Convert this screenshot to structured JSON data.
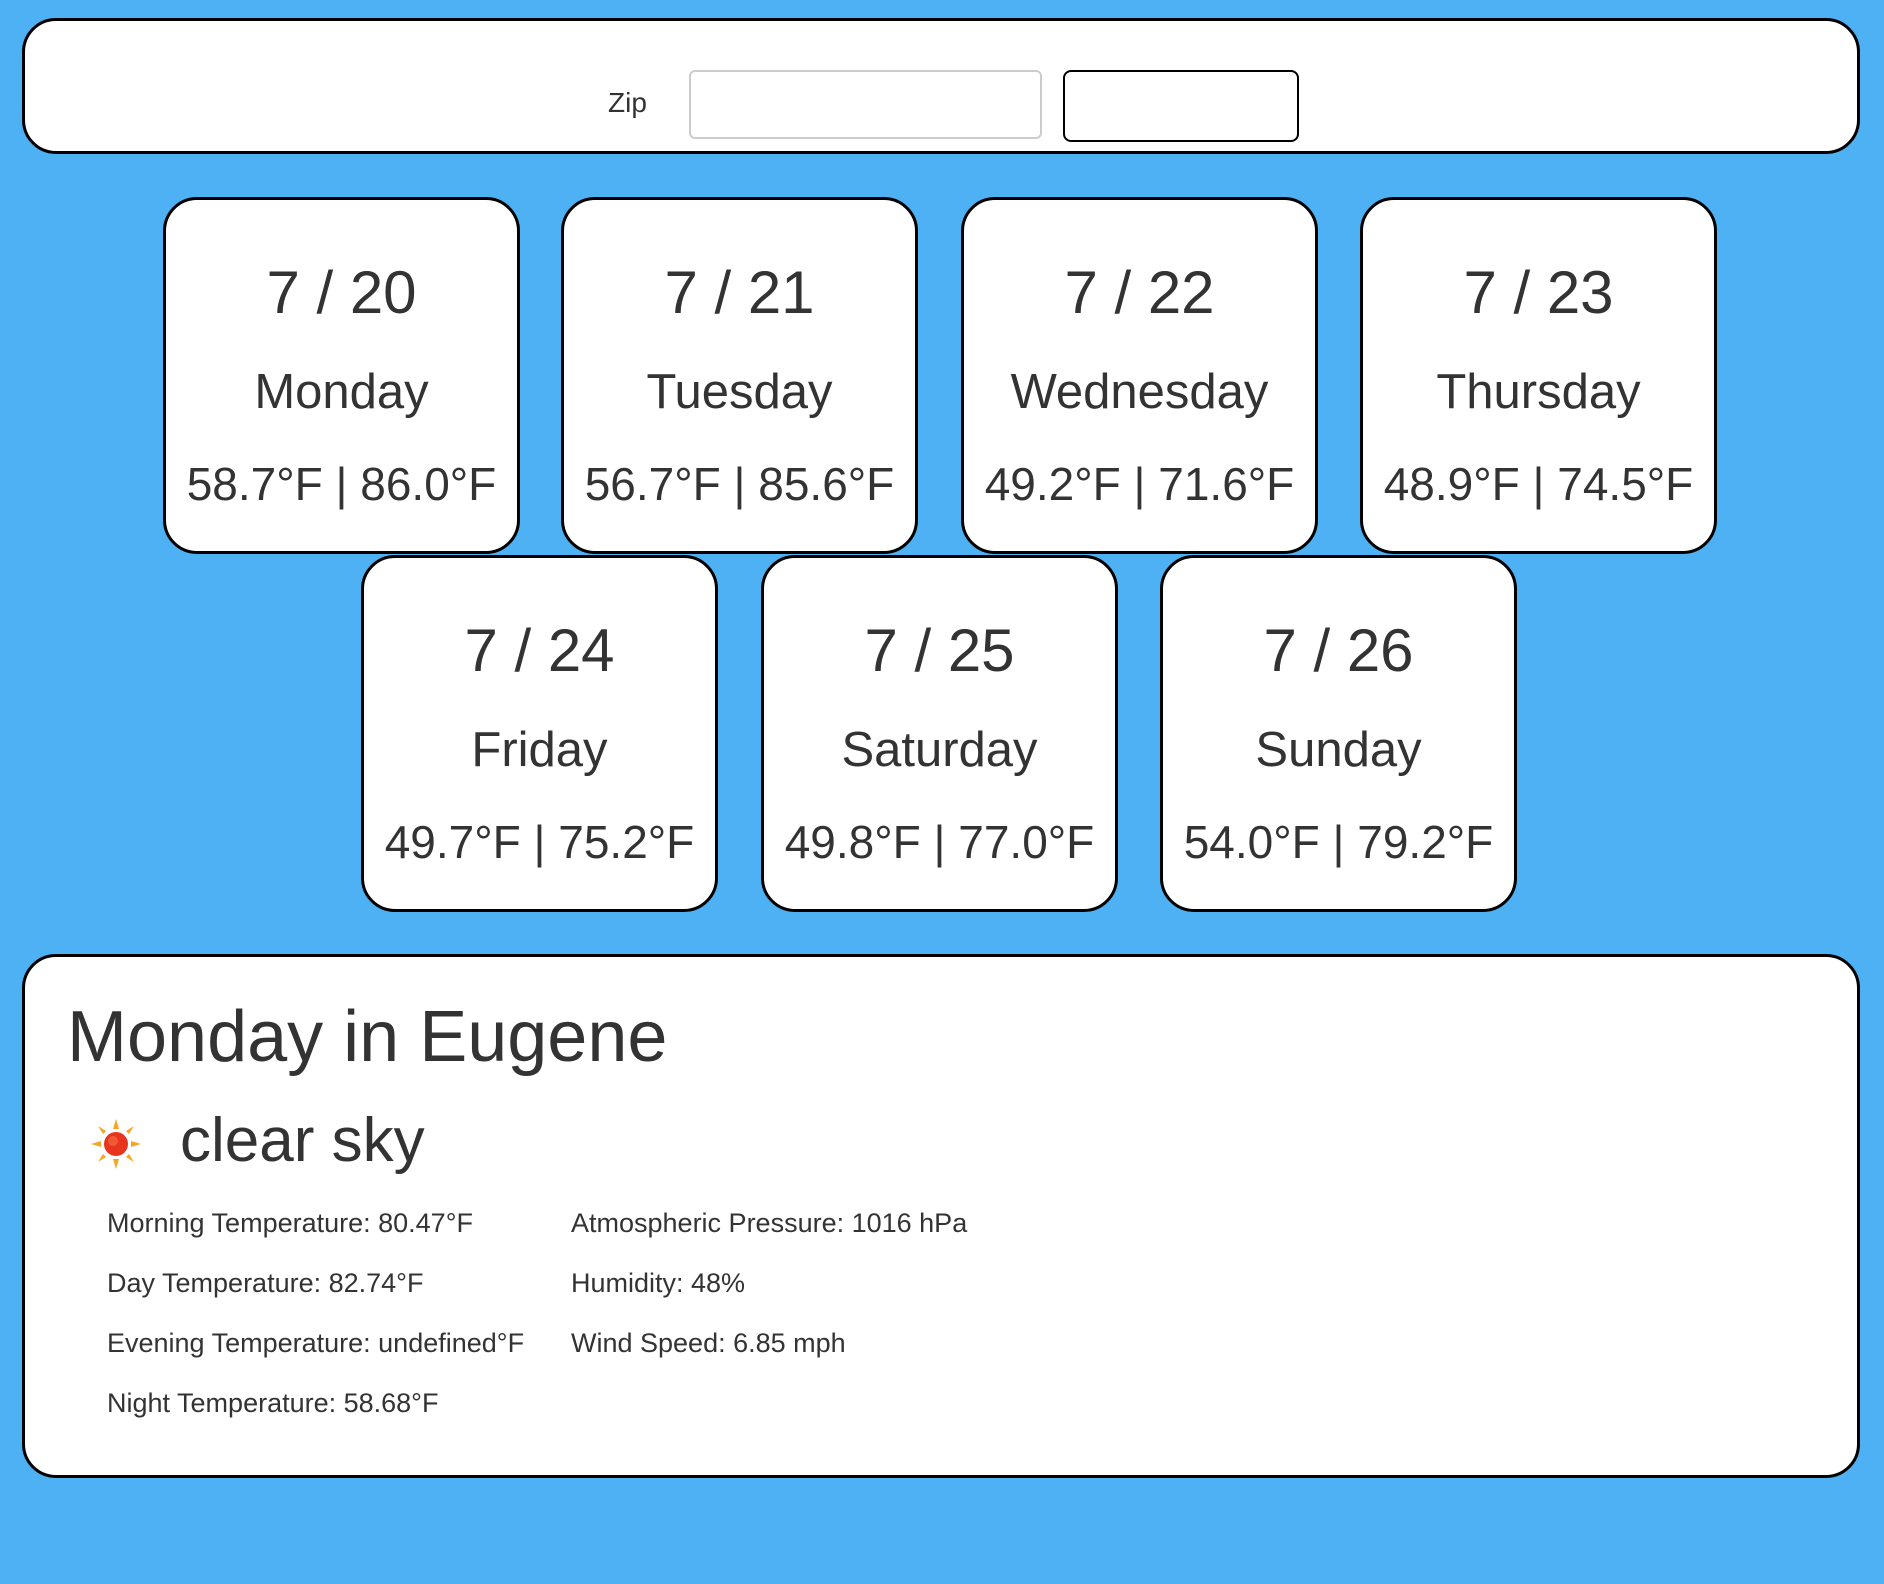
{
  "zip_form": {
    "label": "Zip",
    "input_value": "",
    "input_placeholder": "",
    "button_label": ""
  },
  "forecast": [
    {
      "date": "7 / 20",
      "weekday": "Monday",
      "temps": "58.7°F | 86.0°F"
    },
    {
      "date": "7 / 21",
      "weekday": "Tuesday",
      "temps": "56.7°F | 85.6°F"
    },
    {
      "date": "7 / 22",
      "weekday": "Wednesday",
      "temps": "49.2°F | 71.6°F"
    },
    {
      "date": "7 / 23",
      "weekday": "Thursday",
      "temps": "48.9°F | 74.5°F"
    },
    {
      "date": "7 / 24",
      "weekday": "Friday",
      "temps": "49.7°F | 75.2°F"
    },
    {
      "date": "7 / 25",
      "weekday": "Saturday",
      "temps": "49.8°F | 77.0°F"
    },
    {
      "date": "7 / 26",
      "weekday": "Sunday",
      "temps": "54.0°F | 79.2°F"
    }
  ],
  "details": {
    "title": "Monday in Eugene",
    "icon": "sun-icon",
    "condition": "clear sky",
    "left_stats": [
      "Morning Temperature: 80.47°F",
      "Day Temperature: 82.74°F",
      "Evening Temperature: undefined°F",
      "Night Temperature: 58.68°F"
    ],
    "right_stats": [
      "Atmospheric Pressure: 1016 hPa",
      "Humidity: 48%",
      "Wind Speed: 6.85 mph"
    ]
  },
  "colors": {
    "background": "#4db1f4",
    "card": "#ffffff",
    "border": "#000000",
    "text": "#333333"
  }
}
